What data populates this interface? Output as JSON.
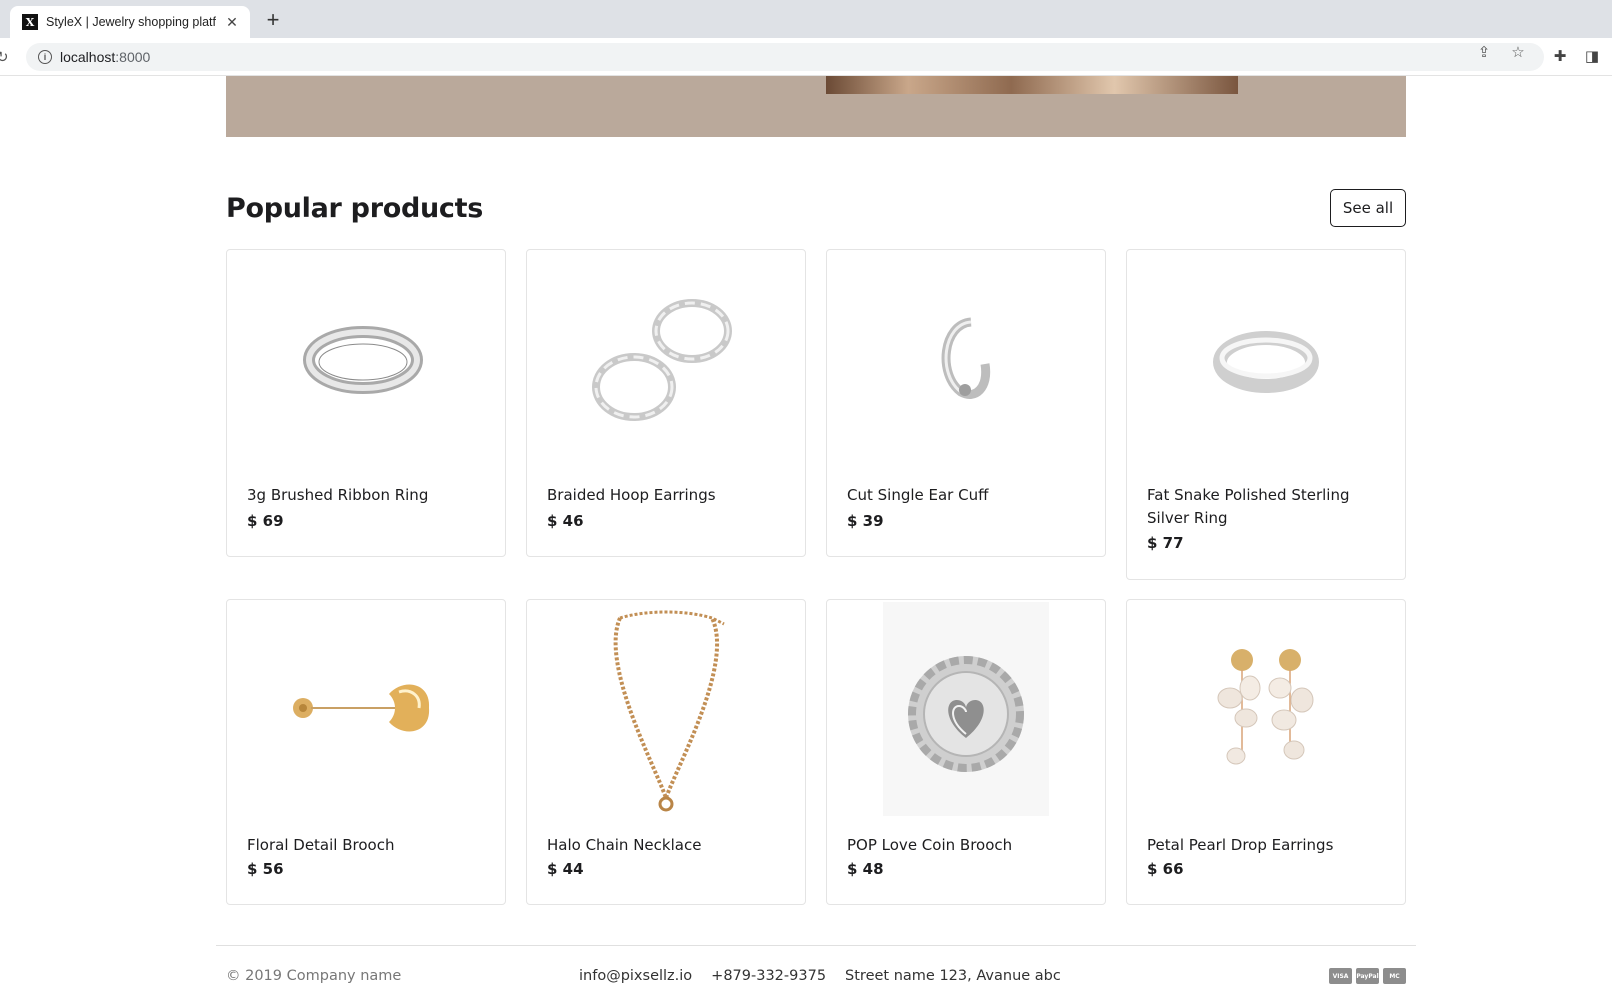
{
  "browser": {
    "tab_title": "StyleX | Jewelry shopping platf",
    "favicon_letter": "X",
    "url_host": "localhost",
    "url_port": ":8000"
  },
  "section": {
    "title": "Popular products",
    "see_all_label": "See all"
  },
  "products": [
    {
      "name": "3g Brushed Ribbon Ring",
      "price": "$ 69",
      "icon": "ring-icon"
    },
    {
      "name": "Braided Hoop Earrings",
      "price": "$ 46",
      "icon": "hoop-earrings-icon"
    },
    {
      "name": "Cut Single Ear Cuff",
      "price": "$ 39",
      "icon": "ear-cuff-icon"
    },
    {
      "name": "Fat Snake Polished Sterling Silver Ring",
      "price": "$ 77",
      "icon": "ring-icon"
    },
    {
      "name": "Floral Detail Brooch",
      "price": "$ 56",
      "icon": "brooch-icon"
    },
    {
      "name": "Halo Chain Necklace",
      "price": "$ 44",
      "icon": "necklace-icon"
    },
    {
      "name": "POP Love Coin Brooch",
      "price": "$ 48",
      "icon": "coin-brooch-icon"
    },
    {
      "name": "Petal Pearl Drop Earrings",
      "price": "$ 66",
      "icon": "pearl-earrings-icon"
    }
  ],
  "footer": {
    "copyright": "© 2019 Company name",
    "email": "info@pixsellz.io",
    "phone": "+879-332-9375",
    "address": "Street name 123, Avanue abc",
    "payments": [
      "VISA",
      "PayPal",
      "MC"
    ]
  },
  "colors": {
    "hero_bg": "#baa99b",
    "silver": "#d9d9d9",
    "gold": "#d9a85a"
  }
}
